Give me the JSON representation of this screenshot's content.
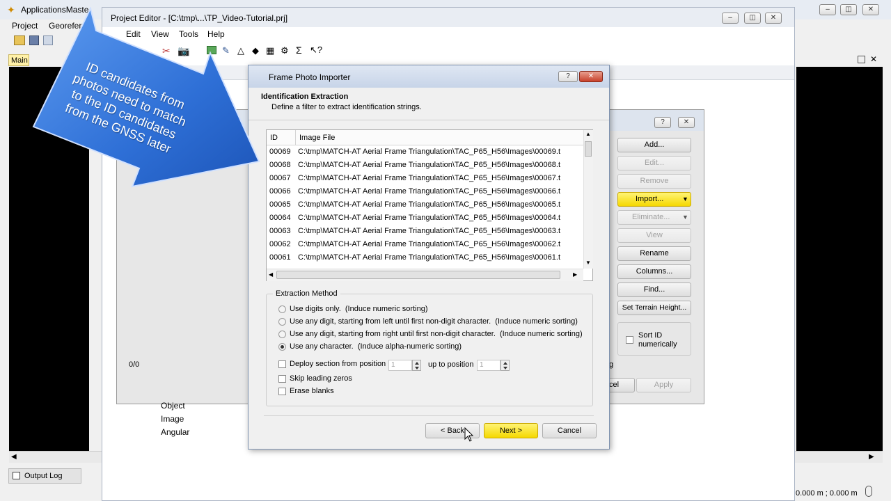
{
  "main_app": {
    "title": "ApplicationsMaste",
    "tab": "Main",
    "menu": [
      "Project",
      "Georefer"
    ],
    "output_log": "Output Log",
    "coords": "0.000 m ; 0.000 m"
  },
  "project_editor": {
    "title": "Project Editor - [C:\\tmp\\...\\TP_Video-Tutorial.prj]",
    "menu": [
      "Edit",
      "View",
      "Tools",
      "Help"
    ],
    "counter": "0/0",
    "tree_items": [
      "Object",
      "Image",
      "Angular"
    ]
  },
  "image_panel": {
    "buttons": {
      "add": "Add...",
      "edit": "Edit...",
      "remove": "Remove",
      "import": "Import...",
      "eliminate": "Eliminate...",
      "view": "View",
      "rename": "Rename",
      "columns": "Columns...",
      "find": "Find...",
      "set_terrain": "Set Terrain Height..."
    },
    "sort_label": "Sort ID numerically",
    "cancel_fragment": "cel",
    "apply": "Apply",
    "g_fragment": "g"
  },
  "dialog": {
    "title": "Frame Photo Importer",
    "heading": "Identification Extraction",
    "subheading": "Define a filter to extract identification strings.",
    "columns": [
      "ID",
      "Image File"
    ],
    "rows": [
      {
        "id": "00069",
        "file": "C:\\tmp\\MATCH-AT Aerial Frame Triangulation\\TAC_P65_H56\\Images\\00069.t"
      },
      {
        "id": "00068",
        "file": "C:\\tmp\\MATCH-AT Aerial Frame Triangulation\\TAC_P65_H56\\Images\\00068.t"
      },
      {
        "id": "00067",
        "file": "C:\\tmp\\MATCH-AT Aerial Frame Triangulation\\TAC_P65_H56\\Images\\00067.t"
      },
      {
        "id": "00066",
        "file": "C:\\tmp\\MATCH-AT Aerial Frame Triangulation\\TAC_P65_H56\\Images\\00066.t"
      },
      {
        "id": "00065",
        "file": "C:\\tmp\\MATCH-AT Aerial Frame Triangulation\\TAC_P65_H56\\Images\\00065.t"
      },
      {
        "id": "00064",
        "file": "C:\\tmp\\MATCH-AT Aerial Frame Triangulation\\TAC_P65_H56\\Images\\00064.t"
      },
      {
        "id": "00063",
        "file": "C:\\tmp\\MATCH-AT Aerial Frame Triangulation\\TAC_P65_H56\\Images\\00063.t"
      },
      {
        "id": "00062",
        "file": "C:\\tmp\\MATCH-AT Aerial Frame Triangulation\\TAC_P65_H56\\Images\\00062.t"
      },
      {
        "id": "00061",
        "file": "C:\\tmp\\MATCH-AT Aerial Frame Triangulation\\TAC_P65_H56\\Images\\00061.t"
      }
    ],
    "method_group": "Extraction Method",
    "options": [
      {
        "label": "Use digits only.  (Induce numeric sorting)",
        "selected": false
      },
      {
        "label": "Use any digit, starting from left until first non-digit character.  (Induce numeric sorting)",
        "selected": false
      },
      {
        "label": "Use any digit, starting from right until first non-digit character.  (Induce numeric sorting)",
        "selected": false
      },
      {
        "label": "Use any character.  (Induce alpha-numeric sorting)",
        "selected": true
      }
    ],
    "deploy_label": "Deploy section from position",
    "deploy_from": "1",
    "up_to_label": "up to position",
    "deploy_to": "1",
    "skip_zeros": "Skip leading zeros",
    "erase_blanks": "Erase blanks",
    "back": "< Back",
    "next": "Next >",
    "cancel": "Cancel",
    "help_glyph": "?"
  },
  "callout": {
    "text": [
      "ID candidates from",
      "photos need to match",
      "to the ID candidates",
      "from the GNSS later"
    ]
  }
}
